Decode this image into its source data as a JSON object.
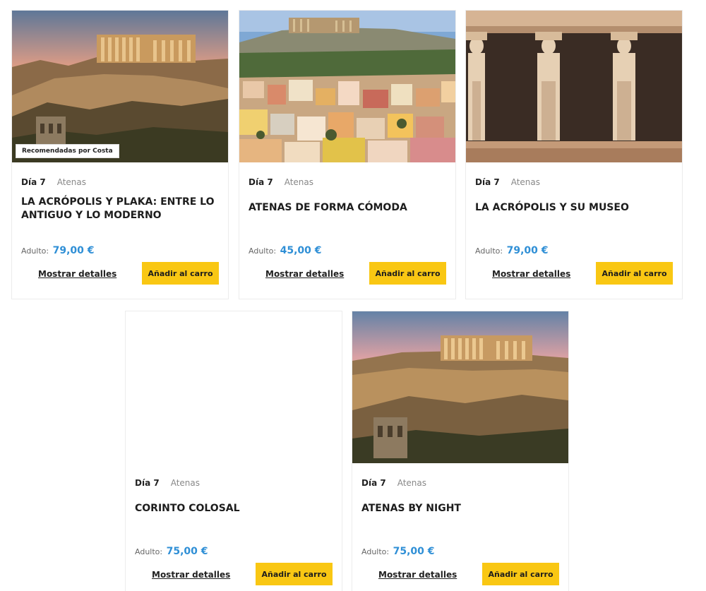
{
  "badge_label": "Recomendadas por Costa",
  "price_prefix": "Adulto:",
  "details_label": "Mostrar detalles",
  "add_to_cart_label": "Añadir al carro",
  "colors": {
    "accent_yellow": "#f9c713",
    "price_blue": "#2f8fd6",
    "card_border": "#ececec"
  },
  "tours": [
    {
      "day": "Día 7",
      "city": "Atenas",
      "title": "LA ACRÓPOLIS Y PLAKA: ENTRE LO ANTIGUO Y LO MODERNO",
      "price": "79,00 €",
      "image": "acropolis-sunset-photo",
      "badge": true
    },
    {
      "day": "Día 7",
      "city": "Atenas",
      "title": "ATENAS DE FORMA CÓMODA",
      "price": "45,00 €",
      "image": "plaka-hillside-houses-photo",
      "badge": false
    },
    {
      "day": "Día 7",
      "city": "Atenas",
      "title": "LA ACRÓPOLIS Y SU MUSEO",
      "price": "79,00 €",
      "image": "caryatids-statues-photo",
      "badge": false
    },
    {
      "day": "Día 7",
      "city": "Atenas",
      "title": "CORINTO COLOSAL",
      "price": "75,00 €",
      "image": "blank-image",
      "badge": false
    },
    {
      "day": "Día 7",
      "city": "Atenas",
      "title": "ATENAS BY NIGHT",
      "price": "75,00 €",
      "image": "acropolis-sunset-photo",
      "badge": false
    }
  ]
}
